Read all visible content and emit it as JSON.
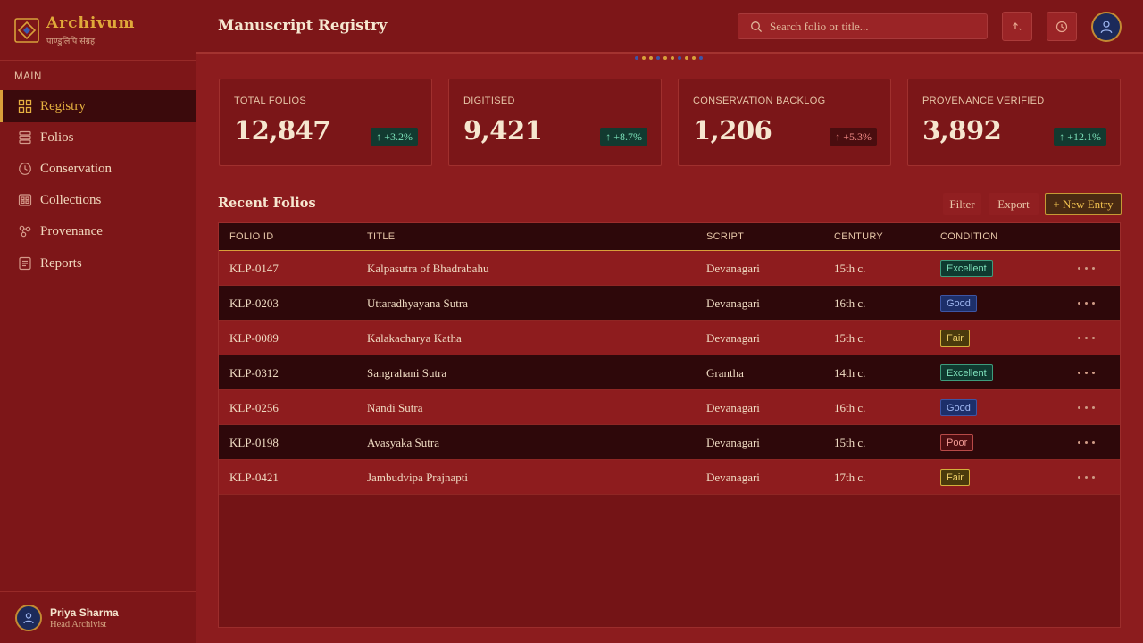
{
  "brand": {
    "name": "Archivum",
    "subtitle": "पाण्डुलिपि संग्रह"
  },
  "sidebar": {
    "section": "MAIN",
    "items": [
      {
        "label": "Registry",
        "icon": "grid-icon",
        "active": true
      },
      {
        "label": "Folios",
        "icon": "stack-icon"
      },
      {
        "label": "Conservation",
        "icon": "clock-icon"
      },
      {
        "label": "Collections",
        "icon": "archive-icon"
      },
      {
        "label": "Provenance",
        "icon": "network-icon"
      },
      {
        "label": "Reports",
        "icon": "document-icon"
      }
    ],
    "user": {
      "name": "Priya Sharma",
      "role": "Head Archivist"
    }
  },
  "header": {
    "title": "Manuscript Registry",
    "search_placeholder": "Search folio or title..."
  },
  "stats": [
    {
      "label": "TOTAL FOLIOS",
      "value": "12,847",
      "change": "+3.2%",
      "trend": "up"
    },
    {
      "label": "DIGITISED",
      "value": "9,421",
      "change": "+8.7%",
      "trend": "up"
    },
    {
      "label": "CONSERVATION BACKLOG",
      "value": "1,206",
      "change": "+5.3%",
      "trend": "down"
    },
    {
      "label": "PROVENANCE VERIFIED",
      "value": "3,892",
      "change": "+12.1%",
      "trend": "up"
    }
  ],
  "recent": {
    "title": "Recent Folios",
    "filter_label": "Filter",
    "export_label": "Export",
    "new_label": "+ New Entry",
    "columns": [
      "FOLIO ID",
      "TITLE",
      "SCRIPT",
      "CENTURY",
      "CONDITION"
    ],
    "rows": [
      {
        "id": "KLP-0147",
        "title": "Kalpasutra of Bhadrabahu",
        "script": "Devanagari",
        "century": "15th c.",
        "condition": "Excellent"
      },
      {
        "id": "KLP-0203",
        "title": "Uttaradhyayana Sutra",
        "script": "Devanagari",
        "century": "16th c.",
        "condition": "Good"
      },
      {
        "id": "KLP-0089",
        "title": "Kalakacharya Katha",
        "script": "Devanagari",
        "century": "15th c.",
        "condition": "Fair"
      },
      {
        "id": "KLP-0312",
        "title": "Sangrahani Sutra",
        "script": "Grantha",
        "century": "14th c.",
        "condition": "Excellent"
      },
      {
        "id": "KLP-0256",
        "title": "Nandi Sutra",
        "script": "Devanagari",
        "century": "16th c.",
        "condition": "Good"
      },
      {
        "id": "KLP-0198",
        "title": "Avasyaka Sutra",
        "script": "Devanagari",
        "century": "15th c.",
        "condition": "Poor"
      },
      {
        "id": "KLP-0421",
        "title": "Jambudvipa Prajnapti",
        "script": "Devanagari",
        "century": "17th c.",
        "condition": "Fair"
      }
    ]
  },
  "colors": {
    "accent": "#d8a03a",
    "background": "#8c1c1e",
    "sidebar": "#7d1618"
  }
}
